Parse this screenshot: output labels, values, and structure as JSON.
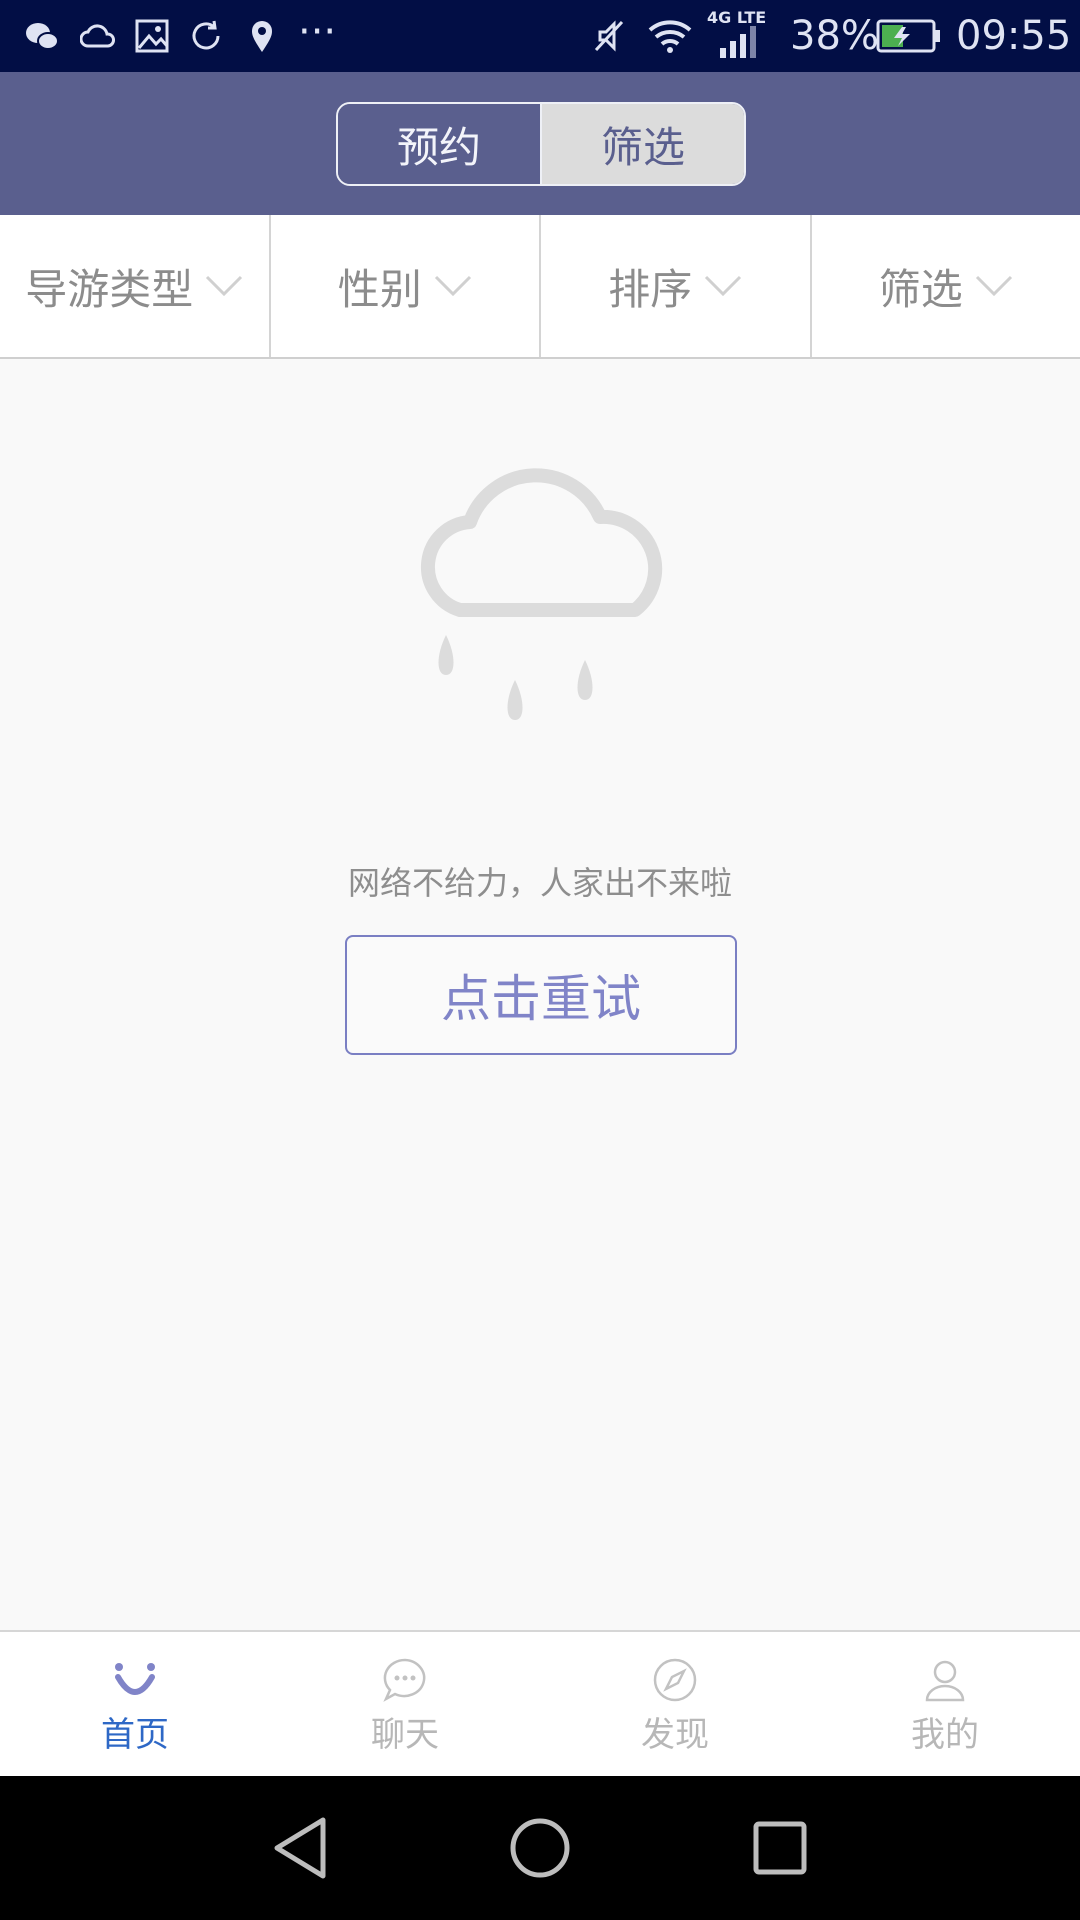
{
  "status_bar": {
    "battery": "38%",
    "time": "09:55",
    "network": "4G LTE",
    "more": "···",
    "left_icons": [
      "wechat-icon",
      "cloud-icon",
      "image-icon",
      "sync-icon",
      "location-icon"
    ]
  },
  "header": {
    "segments": [
      "预约",
      "筛选"
    ],
    "active_segment": "筛选"
  },
  "filters": [
    {
      "label": "导游类型"
    },
    {
      "label": "性别"
    },
    {
      "label": "排序"
    },
    {
      "label": "筛选"
    }
  ],
  "empty_state": {
    "message": "网络不给力，人家出不来啦",
    "retry_label": "点击重试"
  },
  "tabs": [
    {
      "label": "首页",
      "icon": "smile-icon",
      "active": true
    },
    {
      "label": "聊天",
      "icon": "chat-bubble-icon",
      "active": false
    },
    {
      "label": "发现",
      "icon": "compass-icon",
      "active": false
    },
    {
      "label": "我的",
      "icon": "user-icon",
      "active": false
    }
  ],
  "colors": {
    "status_bar": "#020e45",
    "header": "#5a5f8e",
    "accent": "#8084c8",
    "active_tab": "#2e68c6"
  }
}
